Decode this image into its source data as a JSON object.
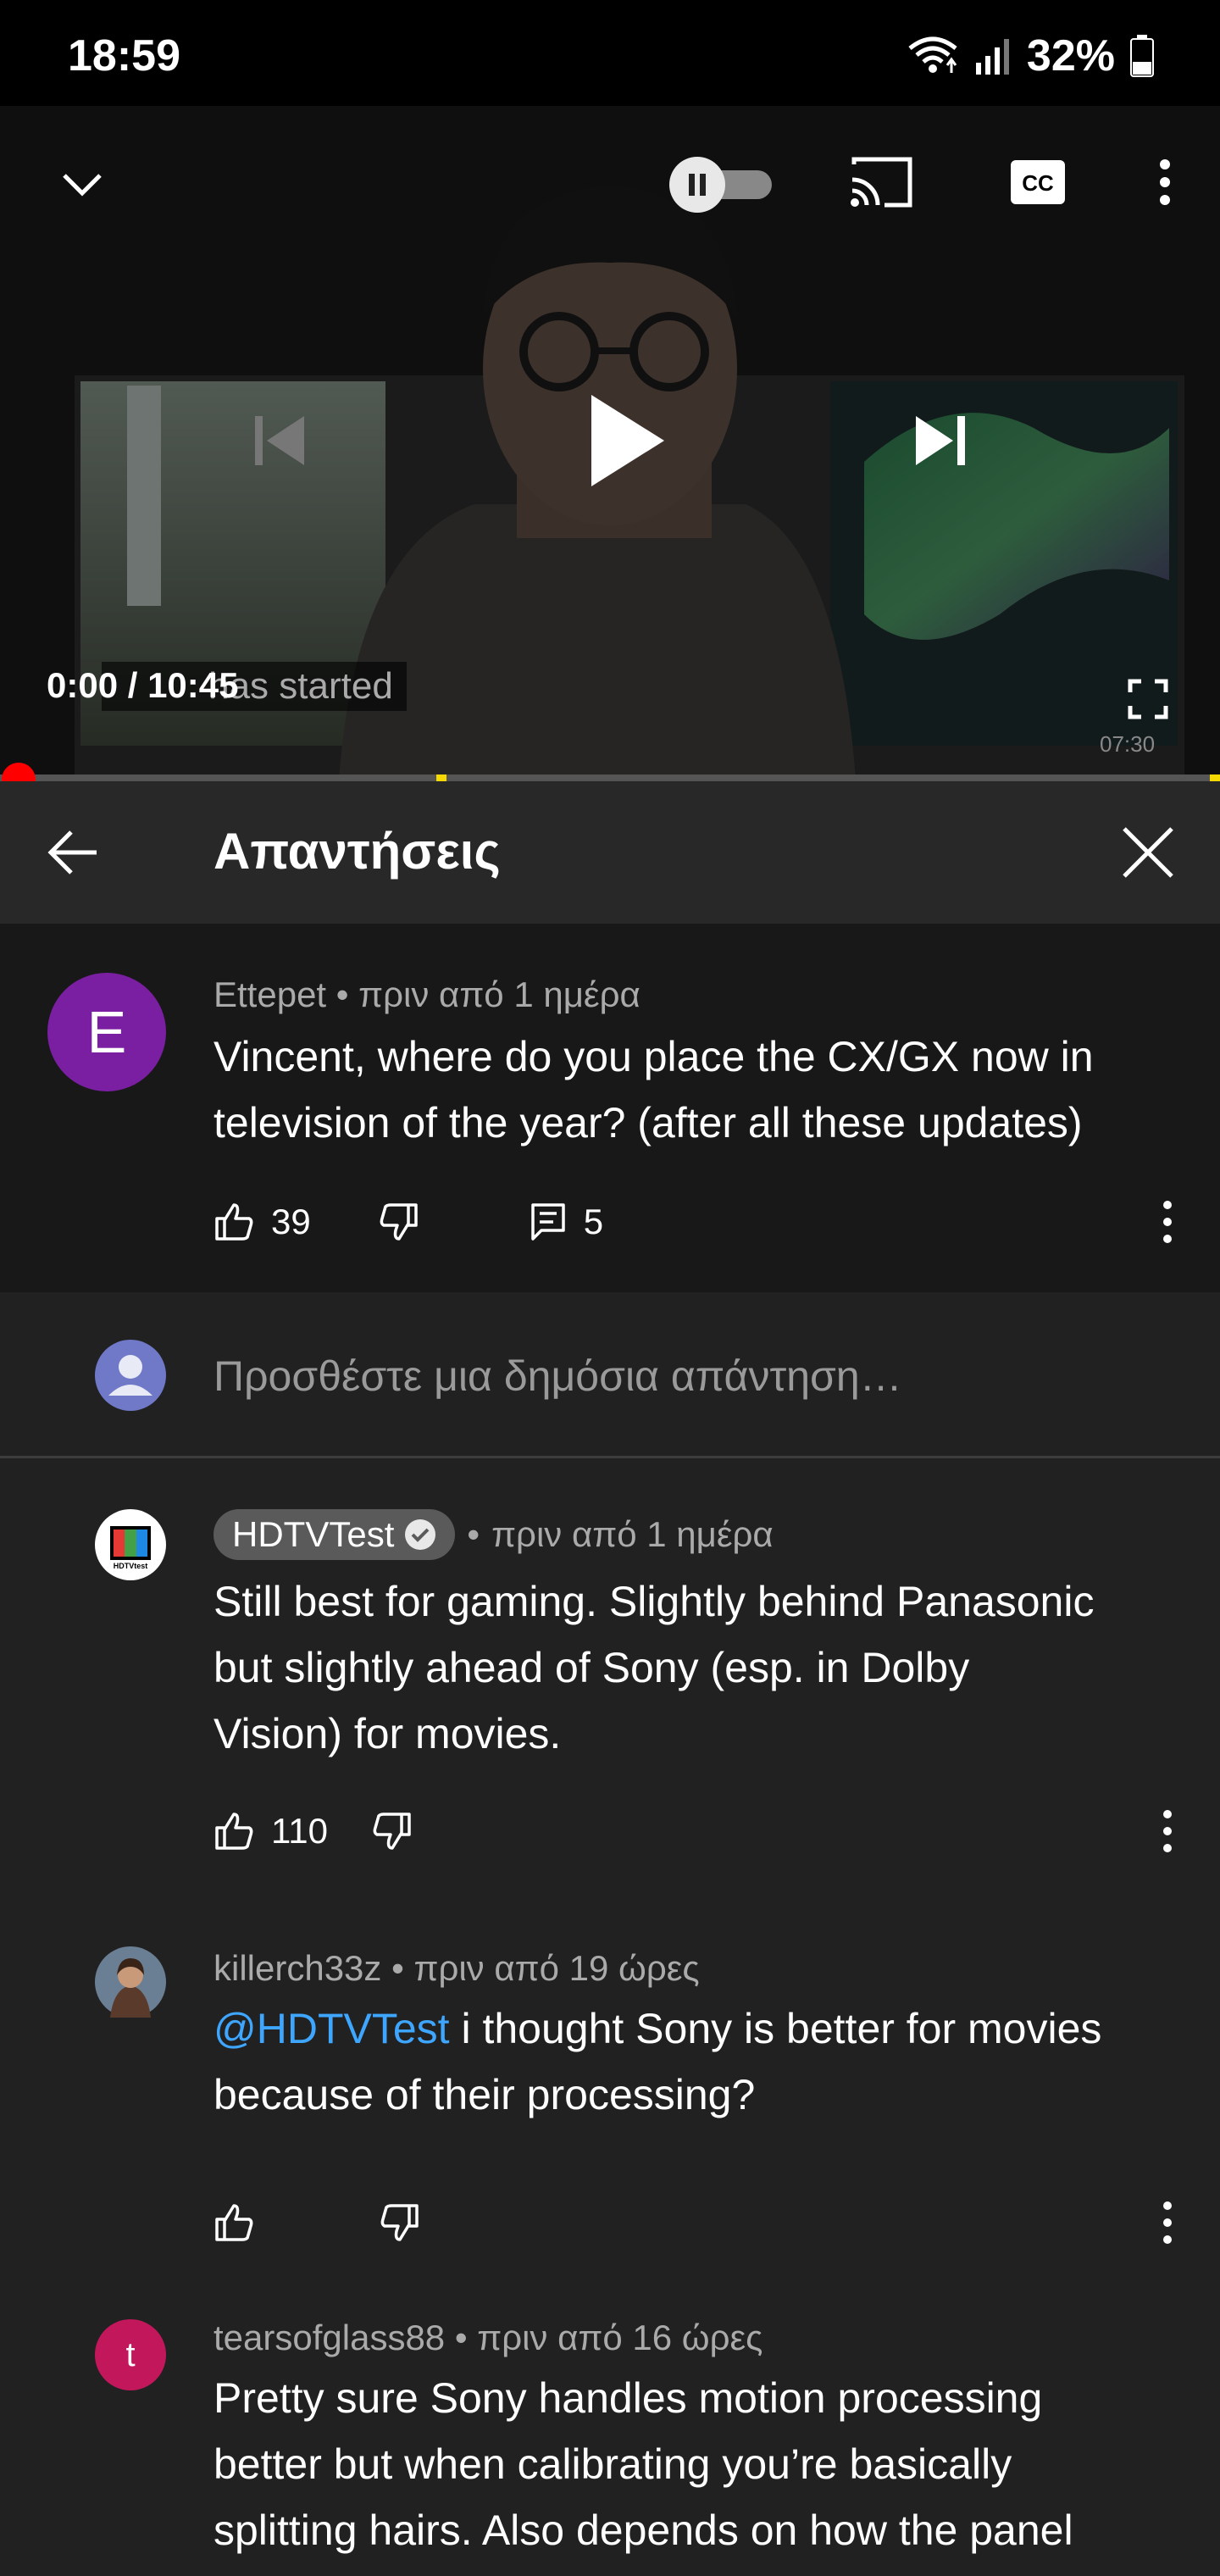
{
  "status_bar": {
    "time": "18:59",
    "battery": "32%"
  },
  "player": {
    "current_time": "0:00",
    "duration": "10:45",
    "time_separator": "/",
    "overlay_caption": "has started",
    "tv_clock": "07:30",
    "progress": 0
  },
  "replies_panel": {
    "title": "Απαντήσεις",
    "parent": {
      "avatar_letter": "E",
      "avatar_color": "#7b1fa2",
      "author": "Ettepet",
      "age": "πριν από 1 ημέρα",
      "text_line1": "Vincent, where do you place the CX/GX now in",
      "text_line2": "television of the year? (after all these updates)",
      "likes": "39",
      "replies": "5"
    },
    "add_reply_placeholder": "Προσθέστε μια δημόσια απάντηση…",
    "replies": [
      {
        "author": "HDTVTest",
        "verified": true,
        "age": "πριν από 1 ημέρα",
        "text_line1": "Still best for gaming. Slightly behind Panasonic",
        "text_line2": "but slightly ahead of Sony (esp. in Dolby",
        "text_line3": "Vision) for movies.",
        "likes": "110"
      },
      {
        "author": "killerch33z",
        "age": "πριν από 19 ώρες",
        "mention": "@HDTVTest",
        "text_line1_rest": " i thought Sony is better for movies",
        "text_line2": "because of their processing?",
        "likes": ""
      },
      {
        "author": "tearsofglass88",
        "avatar_letter": "t",
        "avatar_color": "#c2185b",
        "age": "πριν από 16 ώρες",
        "text_line1": "Pretty sure Sony handles motion processing",
        "text_line2": "better but when calibrating you’re basically",
        "text_line3": "splitting hairs. Also depends on how the panel"
      }
    ],
    "separator": "•"
  }
}
